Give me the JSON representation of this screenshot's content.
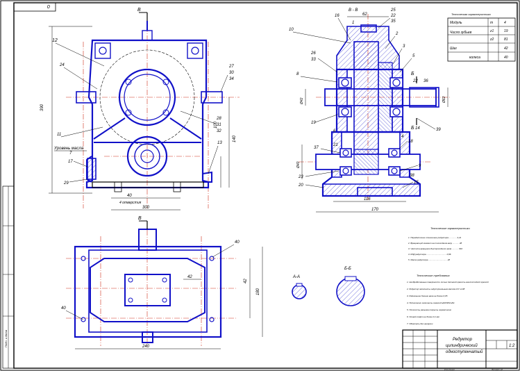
{
  "sheet": {
    "corner_number": "0",
    "section_view_labels": [
      "B",
      "B"
    ],
    "section_b_b_header": "В - В",
    "section_a_a": "А-А",
    "section_b6_b6": "Б-Б"
  },
  "part_numbers": {
    "front": [
      "12",
      "24",
      "27",
      "30",
      "34",
      "28",
      "31",
      "32",
      "11",
      "7",
      "17",
      "29",
      "13"
    ],
    "side": [
      "16",
      "1",
      "25",
      "22",
      "35",
      "10",
      "2",
      "3",
      "26",
      "33",
      "5",
      "8",
      "22",
      "36",
      "19",
      "14",
      "39",
      "4",
      "18",
      "6",
      "37",
      "21",
      "9",
      "23",
      "20",
      "38",
      "15"
    ],
    "plan": [
      "40",
      "40"
    ]
  },
  "annotations": {
    "oil_level": "Уровень масла",
    "section_marker_b6": "Б",
    "section_marker_a": "А",
    "holes_note": "4 отверстия"
  },
  "tables": {
    "params_title": "Техническая характеристика",
    "params": [
      [
        "Модуль",
        "m",
        "4"
      ],
      [
        "Число зубьев",
        "z1",
        "19"
      ],
      [
        "",
        "z2",
        "81"
      ],
      [
        "Шаг",
        "",
        "42"
      ],
      [
        "колеса",
        "",
        "40"
      ]
    ]
  },
  "notes": {
    "tech_title": "Технические характеристики",
    "tech_lines": [
      "1. Передаточное отношение редуктора ............. 4,21",
      "2. Вращающий момент на тихоходном валу ........... 48",
      "3. Частота вращения быстроходного вала ........... 910",
      "4. КПД редуктора .................................. 0,96",
      "5. Масса редуктора ................................ 28"
    ],
    "req_title": "Технические требования",
    "req_lines": [
      "1. Необработанные поверхности литых деталей красить маслостойкой краской",
      "2. Редуктор заполнить индустриальным маслом И-Г-А-68",
      "3. Радиальное биение вала не более 0,05",
      "4. Подшипники заполнить смазкой ЦИАТИМ-201",
      "5. Плоскость разъема покрыть герметиком",
      "6. Осевой люфт не более 0,1 мм",
      "7. Обкатать без нагрузки"
    ]
  },
  "title_block": {
    "name_line1": "Редуктор",
    "name_line2": "цилиндрический",
    "name_line3": "одноступенчатый",
    "sheet_scale": "1:2",
    "left_stamp": "Подп. и дата",
    "bottom_left": "Копировал",
    "bottom_right": "Формат А1"
  },
  "dimensions": {
    "front_width": "300",
    "front_height": "390",
    "axis_center": "100",
    "small_140": "140",
    "base_offset": "40",
    "side_width": "170",
    "side_inner": "116",
    "side_shaft": "62",
    "plan_width": "324",
    "plan_height": "180",
    "right_240": "240",
    "plan_small": "42",
    "left_dim_1": "Ø42",
    "left_dim_2": "Ø40",
    "left_dim_3": "Ø62"
  }
}
